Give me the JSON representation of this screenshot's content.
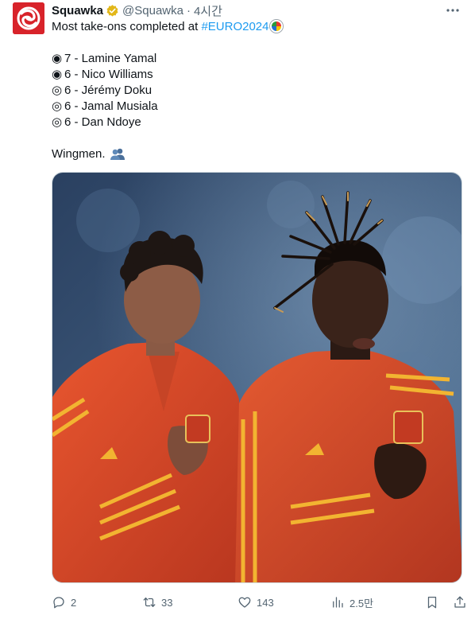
{
  "author": {
    "display_name": "Squawka",
    "handle": "@Squawka",
    "separator": "·",
    "time": "4시간",
    "avatar_icon": "squawka-logo-icon",
    "verified_icon": "verified-badge-icon",
    "verified_color": "#e2b719"
  },
  "tweet": {
    "intro": "Most take-ons completed at ",
    "hashtag": "#EURO2024",
    "ranking": [
      {
        "symbol": "◉",
        "text": "7 - Lamine Yamal"
      },
      {
        "symbol": "◉",
        "text": "6 - Nico Williams"
      },
      {
        "symbol": "◎",
        "text": "6 - Jérémy Doku"
      },
      {
        "symbol": "◎",
        "text": "6 - Jamal Musiala"
      },
      {
        "symbol": "◎",
        "text": "6 - Dan Ndoye"
      }
    ],
    "closing": "Wingmen.",
    "hashtag_color": "#1d9bf0"
  },
  "actions": {
    "replies": "2",
    "retweets": "33",
    "likes": "143",
    "views": "2.5만"
  },
  "colors": {
    "text": "#0f1419",
    "secondary": "#536471",
    "brand_red": "#d8232a",
    "kit_red": "#d9482a",
    "kit_gold": "#f2b431"
  }
}
